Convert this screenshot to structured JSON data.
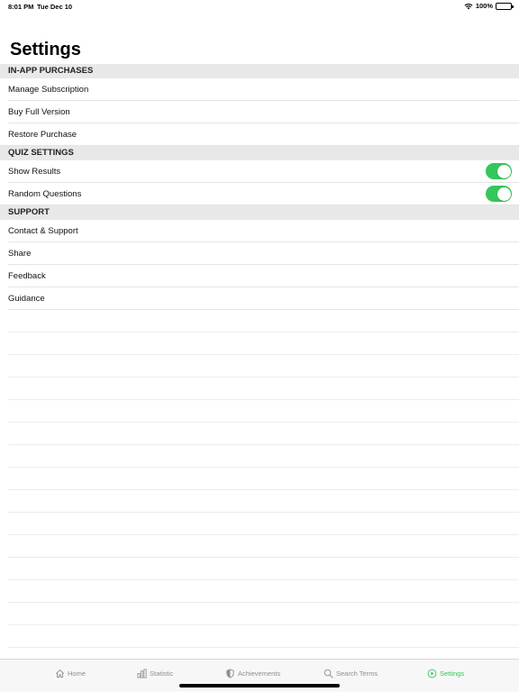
{
  "status_bar": {
    "time": "8:01 PM",
    "date": "Tue Dec 10",
    "battery": "100%"
  },
  "page": {
    "title": "Settings"
  },
  "sections": {
    "in_app": {
      "header": "IN-APP PURCHASES",
      "items": [
        "Manage Subscription",
        "Buy Full Version",
        "Restore Purchase"
      ]
    },
    "quiz": {
      "header": "QUIZ SETTINGS",
      "items": [
        {
          "label": "Show Results",
          "enabled": true
        },
        {
          "label": "Random Questions",
          "enabled": true
        }
      ]
    },
    "support": {
      "header": "SUPPORT",
      "items": [
        "Contact & Support",
        "Share",
        "Feedback",
        "Guidance"
      ]
    }
  },
  "tabs": [
    {
      "label": "Home",
      "icon": "home-icon",
      "active": false
    },
    {
      "label": "Statistic",
      "icon": "bar-chart-icon",
      "active": false
    },
    {
      "label": "Achievements",
      "icon": "shield-icon",
      "active": false
    },
    {
      "label": "Search Terms",
      "icon": "search-icon",
      "active": false
    },
    {
      "label": "Settings",
      "icon": "play-circle-icon",
      "active": true
    }
  ],
  "colors": {
    "accent": "#34c759",
    "section_bg": "#e8e8e8",
    "tab_inactive": "#8e8e93"
  }
}
